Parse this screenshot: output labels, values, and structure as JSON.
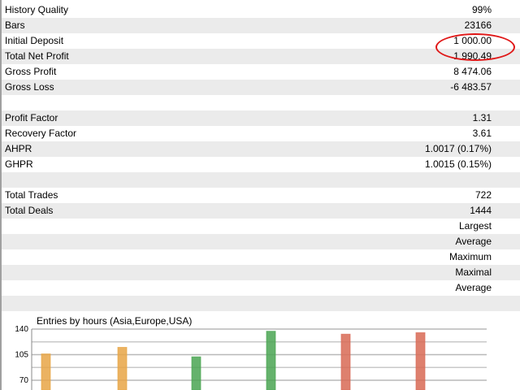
{
  "rows": [
    {
      "label": "History Quality",
      "value": "99%"
    },
    {
      "label": "Bars",
      "value": "23166"
    },
    {
      "label": "Initial Deposit",
      "value": "1 000.00"
    },
    {
      "label": "Total Net Profit",
      "value": "1 990.49"
    },
    {
      "label": "Gross Profit",
      "value": "8 474.06"
    },
    {
      "label": "Gross Loss",
      "value": "-6 483.57"
    },
    {
      "label": "",
      "value": ""
    },
    {
      "label": "Profit Factor",
      "value": "1.31"
    },
    {
      "label": "Recovery Factor",
      "value": "3.61"
    },
    {
      "label": "AHPR",
      "value": "1.0017 (0.17%)"
    },
    {
      "label": "GHPR",
      "value": "1.0015 (0.15%)"
    },
    {
      "label": "",
      "value": ""
    },
    {
      "label": "Total Trades",
      "value": "722"
    },
    {
      "label": "Total Deals",
      "value": "1444"
    },
    {
      "label": "",
      "value": "Largest"
    },
    {
      "label": "",
      "value": "Average"
    },
    {
      "label": "",
      "value": "Maximum"
    },
    {
      "label": "",
      "value": "Maximal"
    },
    {
      "label": "",
      "value": "Average"
    },
    {
      "label": "",
      "value": ""
    }
  ],
  "highlight_color": "#e01818",
  "chart_data": {
    "type": "bar",
    "title": "Entries by hours (Asia,Europe,USA)",
    "xlabel": "",
    "ylabel": "",
    "ylim": [
      70,
      140
    ],
    "yticks": [
      "140",
      "105",
      "70"
    ],
    "grid": true,
    "values": [
      106,
      115,
      102,
      137,
      133,
      135
    ],
    "colors": [
      "#e8a545",
      "#e8a545",
      "#4aa552",
      "#4aa552",
      "#d86a55",
      "#d86a55"
    ]
  }
}
